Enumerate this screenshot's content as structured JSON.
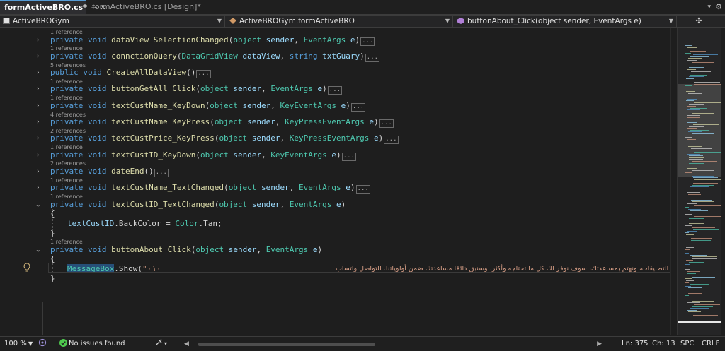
{
  "tabs": {
    "active_label": "formActiveBRO.cs*",
    "inactive_label": "formActiveBRO.cs [Design]*"
  },
  "navbar": {
    "project": "ActiveBROGym",
    "class": "ActiveBROGym.formActiveBRO",
    "member": "buttonAbout_Click(object sender, EventArgs e)"
  },
  "code": {
    "refs": [
      "1 reference",
      "1 reference",
      "5 references",
      "1 reference",
      "1 reference",
      "4 references",
      "2 references",
      "1 reference",
      "2 references",
      "1 reference",
      "1 reference",
      "1 reference"
    ],
    "methods": [
      {
        "mod": "private void",
        "name": "dataView_SelectionChanged",
        "args": [
          [
            "type",
            "object"
          ],
          [
            "param",
            " sender"
          ],
          [
            "plain",
            ", "
          ],
          [
            "type",
            "EventArgs"
          ],
          [
            "param",
            " e"
          ]
        ]
      },
      {
        "mod": "private void",
        "name": "connctionQuery",
        "args": [
          [
            "type",
            "DataGridView"
          ],
          [
            "param",
            " dataView"
          ],
          [
            "plain",
            ", "
          ],
          [
            "kw",
            "string"
          ],
          [
            "param",
            " txtGuary"
          ]
        ]
      },
      {
        "mod": "public void",
        "name": "CreateAllDataView",
        "args": []
      },
      {
        "mod": "private void",
        "name": "buttonGetAll_Click",
        "args": [
          [
            "type",
            "object"
          ],
          [
            "param",
            " sender"
          ],
          [
            "plain",
            ", "
          ],
          [
            "type",
            "EventArgs"
          ],
          [
            "param",
            " e"
          ]
        ]
      },
      {
        "mod": "private void",
        "name": "textCustName_KeyDown",
        "args": [
          [
            "type",
            "object"
          ],
          [
            "param",
            " sender"
          ],
          [
            "plain",
            ", "
          ],
          [
            "type",
            "KeyEventArgs"
          ],
          [
            "param",
            " e"
          ]
        ]
      },
      {
        "mod": "private void",
        "name": "textCustName_KeyPress",
        "args": [
          [
            "type",
            "object"
          ],
          [
            "param",
            " sender"
          ],
          [
            "plain",
            ", "
          ],
          [
            "type",
            "KeyPressEventArgs"
          ],
          [
            "param",
            " e"
          ]
        ]
      },
      {
        "mod": "private void",
        "name": "textCustPrice_KeyPress",
        "args": [
          [
            "type",
            "object"
          ],
          [
            "param",
            " sender"
          ],
          [
            "plain",
            ", "
          ],
          [
            "type",
            "KeyPressEventArgs"
          ],
          [
            "param",
            " e"
          ]
        ]
      },
      {
        "mod": "private void",
        "name": "textCustID_KeyDown",
        "args": [
          [
            "type",
            "object"
          ],
          [
            "param",
            " sender"
          ],
          [
            "plain",
            ", "
          ],
          [
            "type",
            "KeyEventArgs"
          ],
          [
            "param",
            " e"
          ]
        ]
      },
      {
        "mod": "private void",
        "name": "dateEnd",
        "args": []
      },
      {
        "mod": "private void",
        "name": "textCustName_TextChanged",
        "args": [
          [
            "type",
            "object"
          ],
          [
            "param",
            " sender"
          ],
          [
            "plain",
            ", "
          ],
          [
            "type",
            "EventArgs"
          ],
          [
            "param",
            " e"
          ]
        ]
      },
      {
        "mod": "private void",
        "name": "textCustID_TextChanged",
        "args": [
          [
            "type",
            "object"
          ],
          [
            "param",
            " sender"
          ],
          [
            "plain",
            ", "
          ],
          [
            "type",
            "EventArgs"
          ],
          [
            "param",
            " e"
          ]
        ]
      },
      {
        "mod": "private void",
        "name": "buttonAbout_Click",
        "args": [
          [
            "type",
            "object"
          ],
          [
            "param",
            " sender"
          ],
          [
            "plain",
            ", "
          ],
          [
            "type",
            "EventArgs"
          ],
          [
            "param",
            " e"
          ]
        ]
      }
    ],
    "body_backcolor": {
      "target": "textCustID",
      "prop": ".BackColor",
      "eq": " = ",
      "cls": "Color",
      "val": ".Tan;"
    },
    "messagebox": {
      "cls": "MessageBox",
      "call": ".Show(",
      "str": "\"٠١٠",
      "arabic": "صميم التطبيقات، ونهتم بمساعدتك، سوف نوفر لك كل ما تحتاجه وأكثر، وسنبق دائمًا مساعدتك ضمن أولوياتنا. للتواصل واتساب"
    },
    "open_brace": "{",
    "close_brace": "}"
  },
  "status": {
    "zoom": "100 %",
    "issues": "No issues found",
    "line": "Ln: 375",
    "col": "Ch: 13",
    "spc": "SPC",
    "crlf": "CRLF"
  },
  "colors": {
    "keyword": "#569cd6",
    "method": "#dcdcaa",
    "type": "#4ec9b0",
    "param": "#9cdcfe",
    "ok": "#4ec94e"
  }
}
